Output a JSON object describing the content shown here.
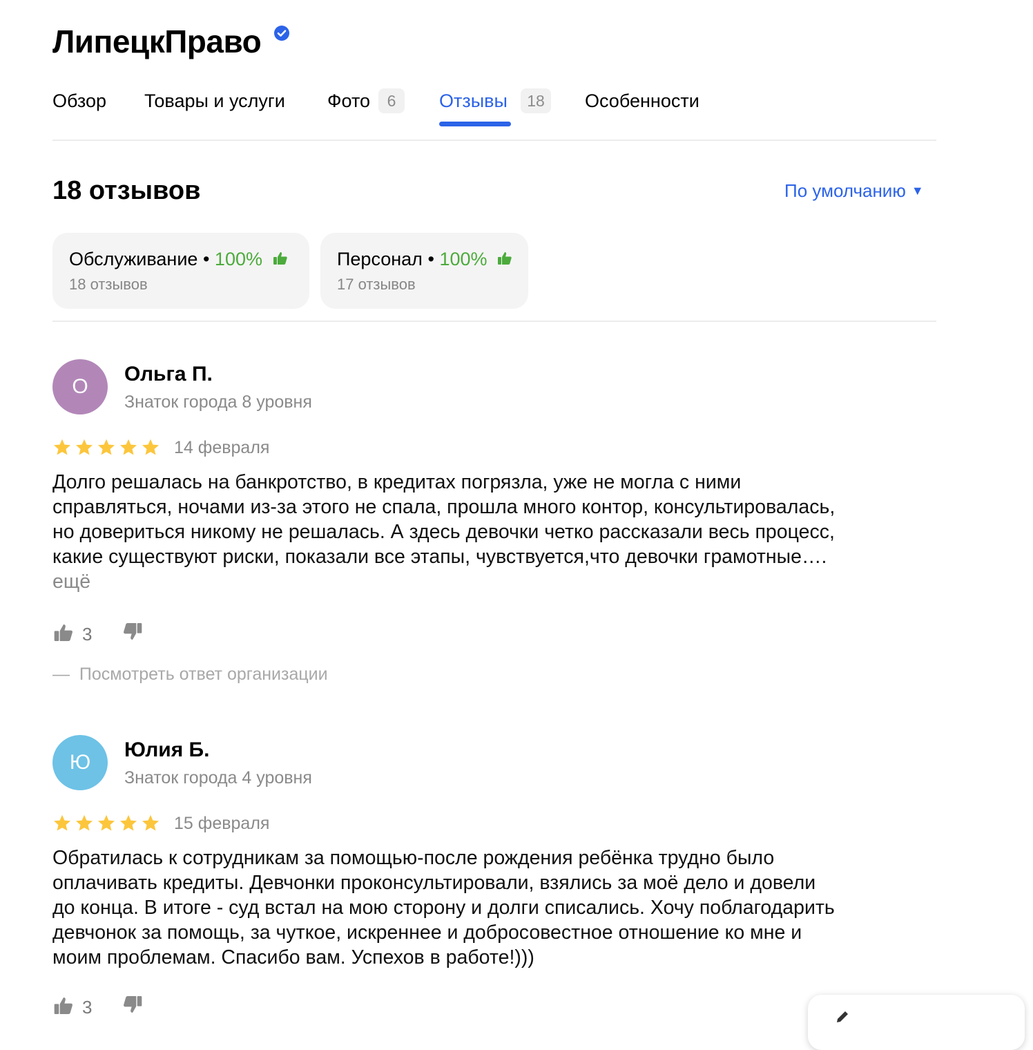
{
  "header": {
    "title": "ЛипецкПраво"
  },
  "tabs": [
    {
      "label": "Обзор"
    },
    {
      "label": "Товары и услуги"
    },
    {
      "label": "Фото",
      "count": "6"
    },
    {
      "label": "Отзывы",
      "count": "18",
      "active": true
    },
    {
      "label": "Особенности"
    }
  ],
  "reviews_header": {
    "count_label": "18 отзывов",
    "sort_label": "По умолчанию"
  },
  "aspects": [
    {
      "name": "Обслуживание",
      "percent": "100%",
      "count_label": "18 отзывов"
    },
    {
      "name": "Персонал",
      "percent": "100%",
      "count_label": "17 отзывов"
    }
  ],
  "reviews": [
    {
      "avatar_letter": "О",
      "avatar_color": "#b287b8",
      "author": "Ольга П.",
      "level": "Знаток города 8 уровня",
      "rating": 5,
      "date": "14 февраля",
      "text_lines": [
        "Долго решалась на банкротство, в кредитах погрязла, уже не могла с ними",
        "справляться, ночами из-за этого не спала, прошла много контор, консультировалась,",
        "но довериться никому не решалась. А здесь девочки четко рассказали весь процесс,",
        "какие существуют риски, показали все этапы, чувствуется,что девочки грамотные…."
      ],
      "more_label": "ещё",
      "likes": "3",
      "org_reply_label": "Посмотреть ответ организации"
    },
    {
      "avatar_letter": "Ю",
      "avatar_color": "#6dc2e6",
      "author": "Юлия Б.",
      "level": "Знаток города 4 уровня",
      "rating": 5,
      "date": "15 февраля",
      "text_lines": [
        "Обратилась к сотрудникам за помощью-после рождения ребёнка трудно было",
        "оплачивать кредиты. Девчонки проконсультировали, взялись за моё дело и довели",
        "до конца. В итоге - суд встал на мою сторону и долги списались. Хочу поблагодарить",
        "девчонок за помощь, за чуткое, искреннее и добросовестное отношение ко мне и",
        "моим проблемам. Спасибо вам. Успехов в работе!)))"
      ],
      "likes": "3"
    }
  ],
  "colors": {
    "accent": "#2c63e8",
    "positive": "#4cab3c",
    "star": "#fcc63c",
    "muted": "#8a8a8a"
  },
  "icons": [
    "verified-badge-icon",
    "thumbs-up-icon",
    "thumbs-down-icon",
    "star-icon",
    "chevron-down-icon",
    "pencil-icon"
  ]
}
